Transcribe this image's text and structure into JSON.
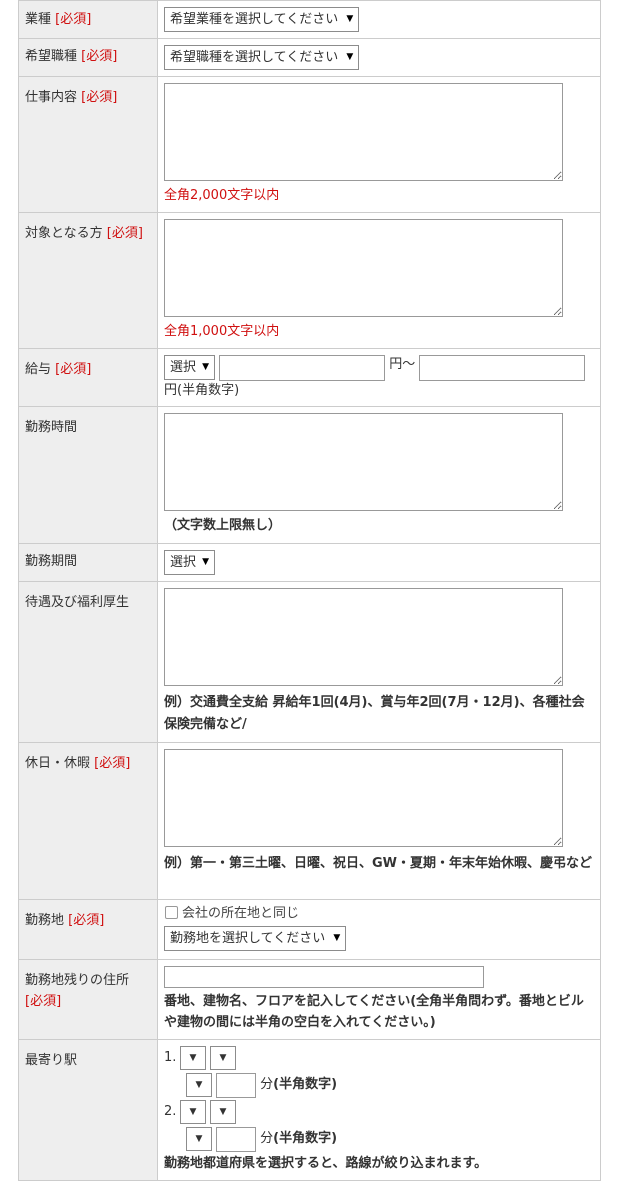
{
  "rows": {
    "industry": {
      "label": "業種",
      "required": "[必須]",
      "select": "希望業種を選択してください"
    },
    "job_type": {
      "label": "希望職種",
      "required": "[必須]",
      "select": "希望職種を選択してください"
    },
    "job_description": {
      "label": "仕事内容",
      "required": "[必須]",
      "note": "全角2,000文字以内"
    },
    "target": {
      "label": "対象となる方",
      "required": "[必須]",
      "note": "全角1,000文字以内"
    },
    "salary": {
      "label": "給与",
      "required": "[必須]",
      "select": "選択",
      "range_sep": "円〜",
      "unit_note": "円(半角数字)"
    },
    "work_hours": {
      "label": "勤務時間",
      "note": "（文字数上限無し）"
    },
    "work_period": {
      "label": "勤務期間",
      "select": "選択"
    },
    "benefits": {
      "label": "待遇及び福利厚生",
      "note": "例）交通費全支給 昇給年1回(4月)、賞与年2回(7月・12月)、各種社会保険完備など/"
    },
    "holidays": {
      "label": "休日・休暇",
      "required": "[必須]",
      "note": "例）第一・第三土曜、日曜、祝日、GW・夏期・年末年始休暇、慶弔など"
    },
    "work_location": {
      "label": "勤務地",
      "required": "[必須]",
      "checkbox_label": "会社の所在地と同じ",
      "select": "勤務地を選択してください"
    },
    "address": {
      "label": "勤務地残りの住所",
      "required": "[必須]",
      "note": "番地、建物名、フロアを記入してください(全角半角問わず。番地とビルや建物の間には半角の空白を入れてください。)"
    },
    "station": {
      "label": "最寄り駅",
      "items": [
        "1.",
        "2."
      ],
      "minutes_label": "分",
      "minutes_note": "(半角数字)",
      "note": "勤務地都道府県を選択すると、路線が絞り込まれます。"
    }
  },
  "icons": {
    "dropdown": "▼"
  }
}
